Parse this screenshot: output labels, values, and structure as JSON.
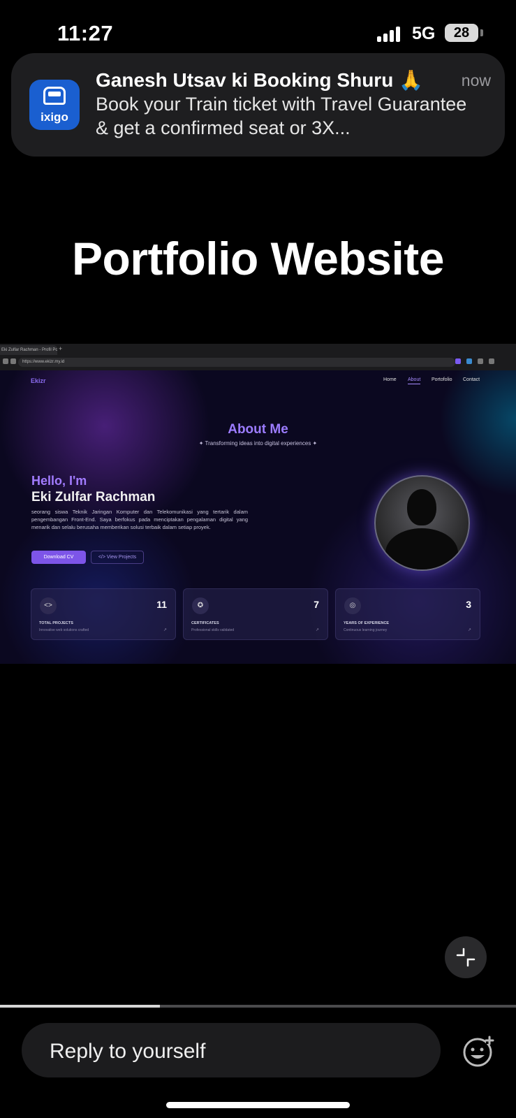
{
  "status_bar": {
    "time": "11:27",
    "network": "5G",
    "battery": "28"
  },
  "notification": {
    "app_icon_text": "ixigo",
    "title": "Ganesh Utsav ki Booking Shuru 🙏",
    "time": "now",
    "body": "Book your Train ticket with Travel Guarantee & get a confirmed seat or 3X..."
  },
  "story": {
    "title": "Portfolio Website",
    "progress_fraction": 0.31
  },
  "browser": {
    "tab_title": "Eki Zulfar Rachman - Profil Por",
    "url": "https://www.ekizr.my.id"
  },
  "site": {
    "logo": "Ekizr",
    "nav": [
      "Home",
      "About",
      "Portofolio",
      "Contact"
    ],
    "active_nav": "About",
    "heading": "About Me",
    "subheading": "✦ Transforming ideas into digital experiences ✦",
    "hello": "Hello, I'm",
    "name": "Eki Zulfar Rachman",
    "bio": "seorang siswa Teknik Jaringan Komputer dan Telekomunikasi yang tertarik dalam pengembangan Front-End. Saya berfokus pada menciptakan pengalaman digital yang menarik dan selalu berusaha memberikan solusi terbaik dalam setiap proyek.",
    "download_cv": "Download CV",
    "view_projects": "</> View Projects",
    "stats": [
      {
        "icon": "code-icon",
        "value": "11",
        "label": "TOTAL PROJECTS",
        "desc": "Innovative web solutions crafted"
      },
      {
        "icon": "award-icon",
        "value": "7",
        "label": "CERTIFICATES",
        "desc": "Professional skills validated"
      },
      {
        "icon": "globe-icon",
        "value": "3",
        "label": "YEARS OF EXPERIENCE",
        "desc": "Continuous learning journey"
      }
    ]
  },
  "reply": {
    "placeholder": "Reply to yourself"
  }
}
